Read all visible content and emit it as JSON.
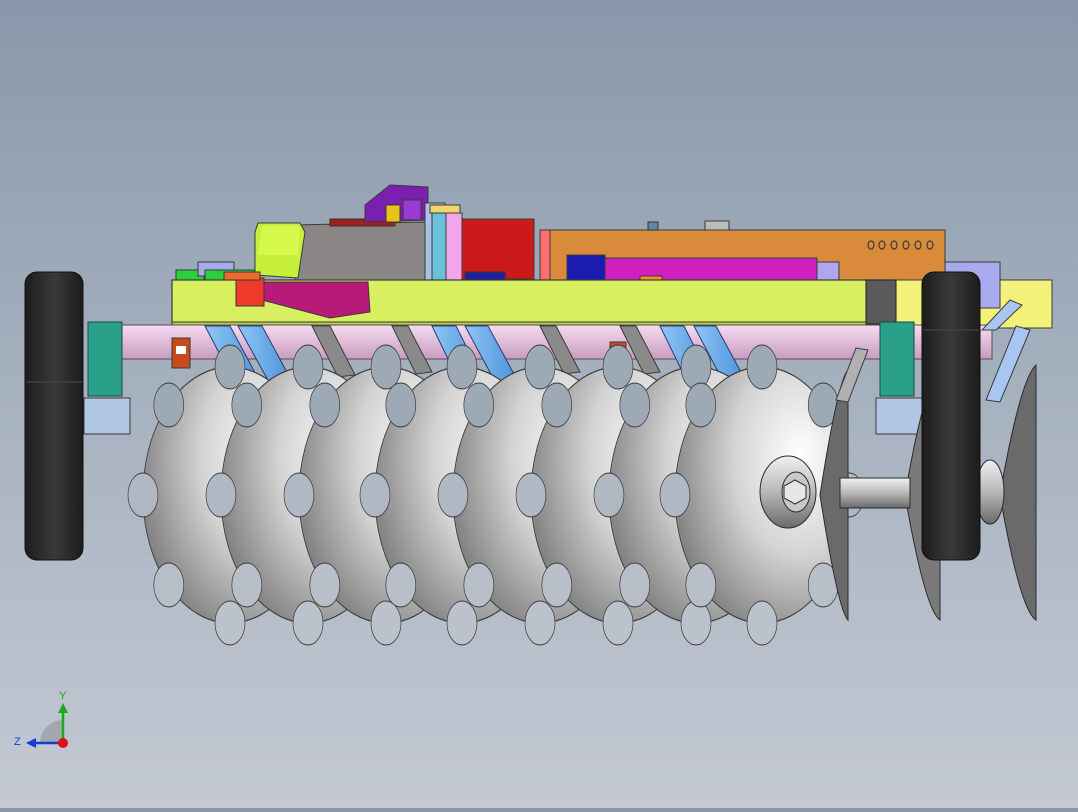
{
  "viewport": {
    "model": "disc-harrow-assembly",
    "view": "side",
    "colors": {
      "background_top": "#8898aa",
      "background_bottom": "#c4c9d3",
      "frame": "#d8f060",
      "disc": "#c8c8c8",
      "tire": "#2a2a2a",
      "beam_orange": "#d98a3a",
      "panel_magenta": "#d020c0",
      "block_red": "#cc1a1a",
      "bracket_purple": "#7a1fb0",
      "shank_blue": "#6aaae8",
      "axle_pink": "#f0c8e8",
      "hub_teal": "#2aa08a"
    }
  },
  "triad": {
    "y_label": "Y",
    "z_label": "Z",
    "y_color": "#1aaa1a",
    "z_color": "#1a3ad8",
    "origin_color": "#e01010"
  }
}
